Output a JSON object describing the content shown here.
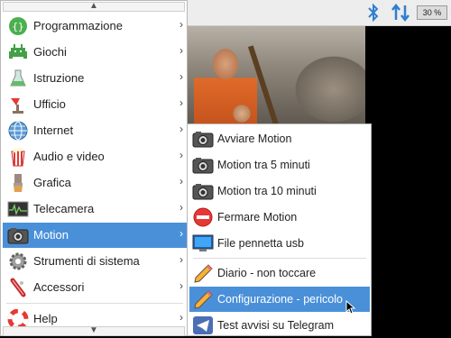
{
  "panel": {
    "bluetooth_icon": "bluetooth-icon",
    "network_icon": "network-updown-icon",
    "cpu_label": "30 %"
  },
  "menu": {
    "items": [
      {
        "label": "Programmazione",
        "icon": "programming-icon"
      },
      {
        "label": "Giochi",
        "icon": "games-icon"
      },
      {
        "label": "Istruzione",
        "icon": "education-icon"
      },
      {
        "label": "Ufficio",
        "icon": "office-icon"
      },
      {
        "label": "Internet",
        "icon": "internet-globe-icon"
      },
      {
        "label": "Audio e video",
        "icon": "audio-video-icon"
      },
      {
        "label": "Grafica",
        "icon": "graphics-brush-icon"
      },
      {
        "label": "Telecamera",
        "icon": "camera-icon"
      },
      {
        "label": "Motion",
        "icon": "motion-camera-icon"
      },
      {
        "label": "Strumenti di sistema",
        "icon": "system-tools-icon"
      },
      {
        "label": "Accessori",
        "icon": "accessories-icon"
      },
      {
        "label": "Help",
        "icon": "help-lifebuoy-icon"
      }
    ]
  },
  "submenu": {
    "items": [
      {
        "label": "Avviare Motion",
        "icon": "camera-icon"
      },
      {
        "label": "Motion tra 5 minuti",
        "icon": "camera-icon"
      },
      {
        "label": "Motion tra 10 minuti",
        "icon": "camera-icon"
      },
      {
        "label": "Fermare Motion",
        "icon": "stop-icon"
      },
      {
        "label": "File pennetta usb",
        "icon": "monitor-icon"
      },
      {
        "label": "Diario - non toccare",
        "icon": "pencil-icon"
      },
      {
        "label": "Configurazione - pericolo",
        "icon": "pencil-icon"
      },
      {
        "label": "Test avvisi su Telegram",
        "icon": "telegram-icon"
      }
    ]
  },
  "colors": {
    "highlight": "#4a90d9",
    "panel_bg": "#ededed",
    "bluetooth": "#2f7fd0"
  }
}
